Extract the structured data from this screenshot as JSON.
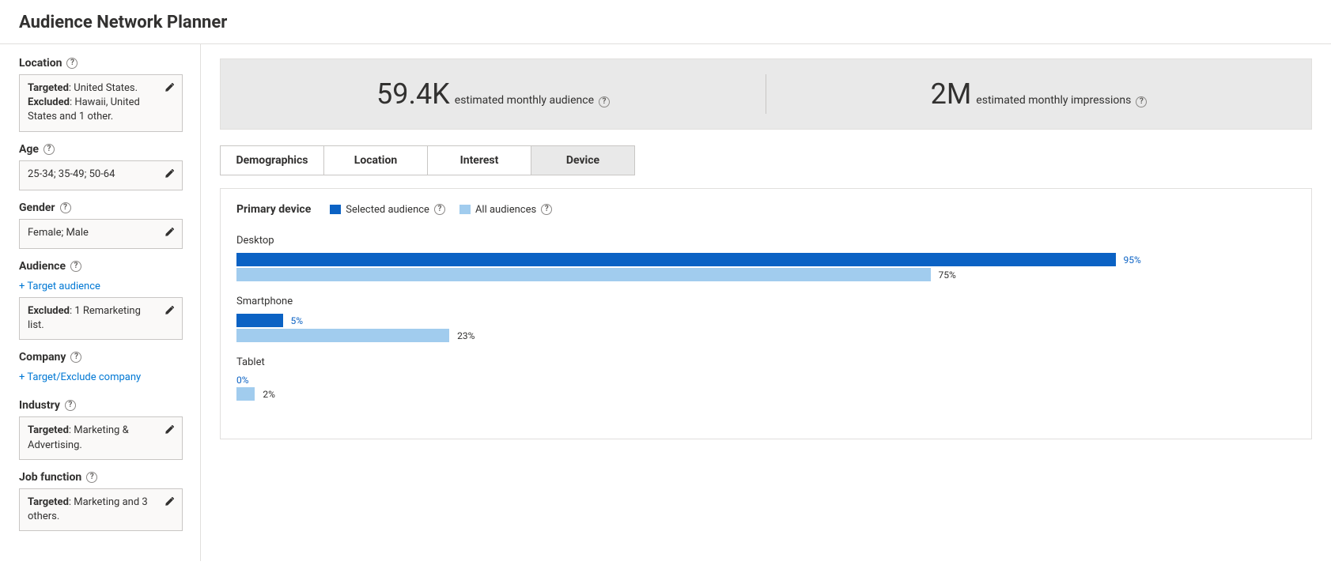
{
  "page_title": "Audience Network Planner",
  "sidebar": {
    "location": {
      "heading": "Location",
      "targeted_label": "Targeted",
      "targeted_value": ": United States.",
      "excluded_label": "Excluded",
      "excluded_value": ": Hawaii, United States and 1 other."
    },
    "age": {
      "heading": "Age",
      "value": "25-34; 35-49; 50-64"
    },
    "gender": {
      "heading": "Gender",
      "value": "Female; Male"
    },
    "audience": {
      "heading": "Audience",
      "add_link": "+ Target audience",
      "excluded_label": "Excluded",
      "excluded_value": ": 1 Remarketing list."
    },
    "company": {
      "heading": "Company",
      "add_link": "+ Target/Exclude company"
    },
    "industry": {
      "heading": "Industry",
      "targeted_label": "Targeted",
      "targeted_value": ": Marketing & Advertising."
    },
    "job_function": {
      "heading": "Job function",
      "targeted_label": "Targeted",
      "targeted_value": ": Marketing and 3 others."
    }
  },
  "summary": {
    "audience_value": "59.4K",
    "audience_label": "estimated monthly audience",
    "impressions_value": "2M",
    "impressions_label": "estimated monthly impressions"
  },
  "tabs": {
    "demographics": "Demographics",
    "location": "Location",
    "interest": "Interest",
    "device": "Device",
    "active": "device"
  },
  "panel": {
    "title": "Primary device",
    "legend_selected": "Selected audience",
    "legend_all": "All audiences"
  },
  "chart_data": {
    "type": "bar",
    "title": "Primary device",
    "categories": [
      "Desktop",
      "Smartphone",
      "Tablet"
    ],
    "series": [
      {
        "name": "Selected audience",
        "values": [
          95,
          5,
          0
        ]
      },
      {
        "name": "All audiences",
        "values": [
          75,
          23,
          2
        ]
      }
    ],
    "xlabel": "",
    "ylabel": "",
    "ylim": [
      0,
      100
    ],
    "value_suffix": "%"
  }
}
